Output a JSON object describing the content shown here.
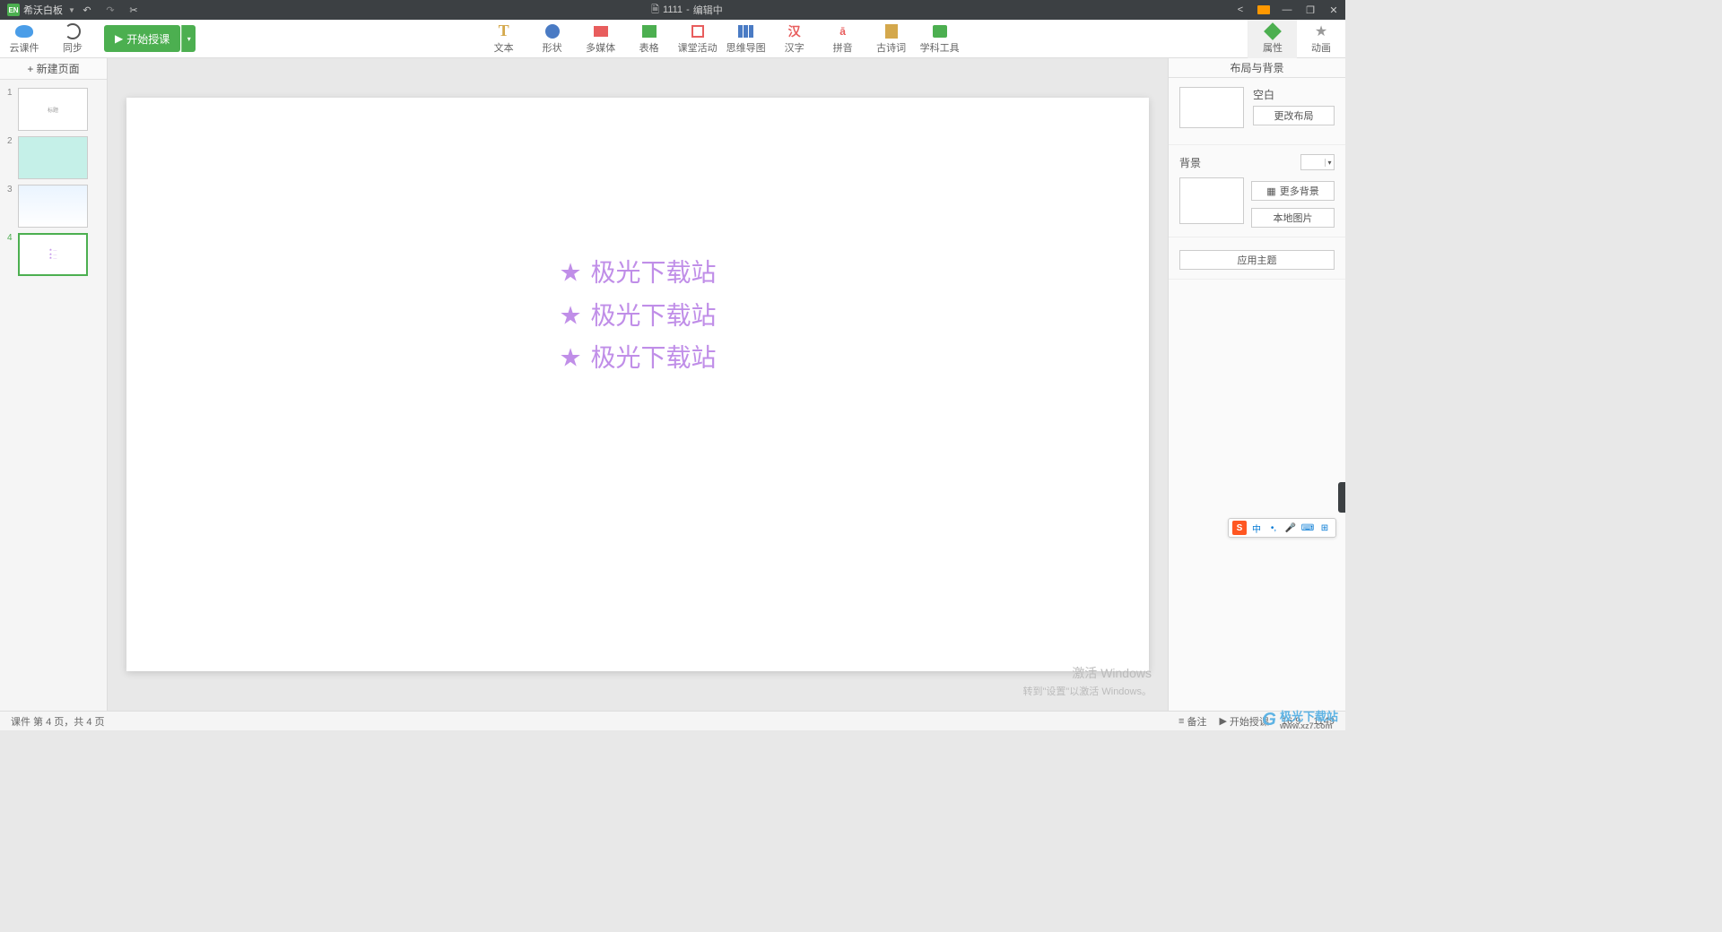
{
  "titlebar": {
    "app_badge": "EN",
    "app_name": "希沃白板",
    "doc_name": "1111",
    "doc_status": "编辑中"
  },
  "toolbar": {
    "cloud": "云课件",
    "sync": "同步",
    "start_class": "开始授课",
    "center": {
      "text": "文本",
      "shape": "形状",
      "media": "多媒体",
      "table": "表格",
      "activity": "课堂活动",
      "mindmap": "思维导图",
      "hanzi": "汉字",
      "pinyin": "拼音",
      "poem": "古诗词",
      "subject": "学科工具"
    },
    "right": {
      "properties": "属性",
      "animation": "动画"
    }
  },
  "slides": {
    "new_page": "新建页面",
    "items": [
      "1",
      "2",
      "3",
      "4"
    ]
  },
  "canvas": {
    "lines": [
      "极光下载站",
      "极光下载站",
      "极光下载站"
    ]
  },
  "rpanel": {
    "header": "布局与背景",
    "layout_name": "空白",
    "change_layout": "更改布局",
    "bg_label": "背景",
    "more_bg": "更多背景",
    "local_img": "本地图片",
    "apply_theme": "应用主题"
  },
  "statusbar": {
    "page_info": "课件 第 4 页，共 4 页",
    "notes": "备注",
    "start": "开始授课",
    "ratio": "16:9",
    "dims": "1149"
  },
  "watermark": {
    "line1": "激活 Windows",
    "line2": "转到\"设置\"以激活 Windows。",
    "brand": "极光下载站",
    "url": "www.xz7.com"
  },
  "ime": {
    "lang": "中"
  }
}
